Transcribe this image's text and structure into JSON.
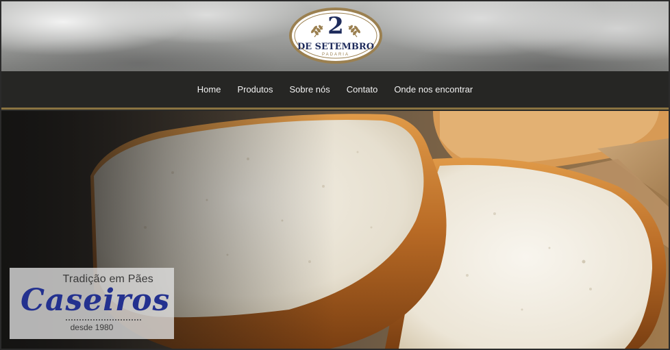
{
  "logo": {
    "number": "2",
    "name": "De setembro",
    "subtitle": "PADARIA",
    "colors": {
      "navy": "#1f2c5c",
      "gold": "#9b8050"
    }
  },
  "nav": {
    "items": [
      {
        "label": "Home"
      },
      {
        "label": "Produtos"
      },
      {
        "label": "Sobre nós"
      },
      {
        "label": "Contato"
      },
      {
        "label": "Onde nos encontrar"
      }
    ]
  },
  "hero": {
    "badge": {
      "top": "Tradição em Pães",
      "main": "Caseiros",
      "sub": "desde 1980"
    }
  },
  "colors": {
    "navbar": "#262624",
    "accent_border": "#8a7441",
    "badge_text": "#23318f"
  }
}
